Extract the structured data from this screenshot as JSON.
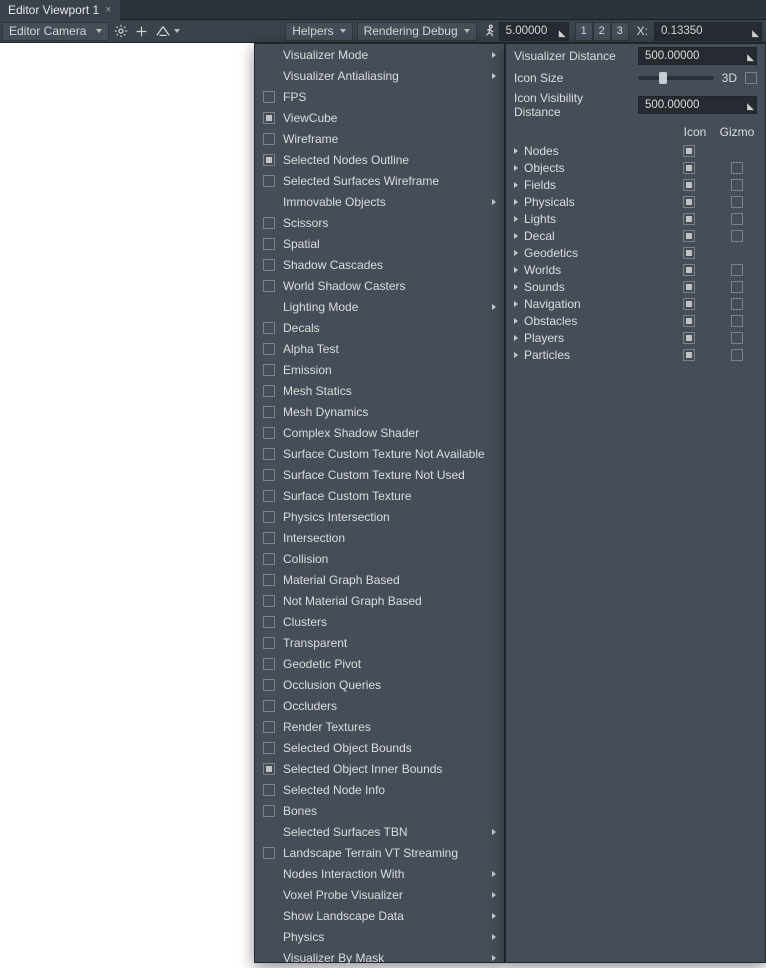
{
  "title": "Editor Viewport 1",
  "camera_dropdown": "Editor Camera",
  "toolbar": {
    "helpers": "Helpers",
    "rendering_debug": "Rendering Debug",
    "speed": "5.00000",
    "views": [
      "1",
      "2",
      "3"
    ],
    "axis_label": "X:",
    "axis_value": "0.13350"
  },
  "helpers_menu": [
    {
      "k": "sub",
      "label": "Visualizer Mode"
    },
    {
      "k": "sub",
      "label": "Visualizer Antialiasing"
    },
    {
      "k": "cb",
      "label": "FPS"
    },
    {
      "k": "ind",
      "label": "ViewCube"
    },
    {
      "k": "cb",
      "label": "Wireframe"
    },
    {
      "k": "ind",
      "label": "Selected Nodes Outline"
    },
    {
      "k": "cb",
      "label": "Selected Surfaces Wireframe"
    },
    {
      "k": "sub",
      "label": "Immovable Objects"
    },
    {
      "k": "cb",
      "label": "Scissors"
    },
    {
      "k": "cb",
      "label": "Spatial"
    },
    {
      "k": "cb",
      "label": "Shadow Cascades"
    },
    {
      "k": "cb",
      "label": "World Shadow Casters"
    },
    {
      "k": "sub",
      "label": "Lighting Mode"
    },
    {
      "k": "cb",
      "label": "Decals"
    },
    {
      "k": "cb",
      "label": "Alpha Test"
    },
    {
      "k": "cb",
      "label": "Emission"
    },
    {
      "k": "cb",
      "label": "Mesh Statics"
    },
    {
      "k": "cb",
      "label": "Mesh Dynamics"
    },
    {
      "k": "cb",
      "label": "Complex Shadow Shader"
    },
    {
      "k": "cb",
      "label": "Surface Custom Texture Not Available"
    },
    {
      "k": "cb",
      "label": "Surface Custom Texture Not Used"
    },
    {
      "k": "cb",
      "label": "Surface Custom Texture"
    },
    {
      "k": "cb",
      "label": "Physics Intersection"
    },
    {
      "k": "cb",
      "label": "Intersection"
    },
    {
      "k": "cb",
      "label": "Collision"
    },
    {
      "k": "cb",
      "label": "Material Graph Based"
    },
    {
      "k": "cb",
      "label": "Not Material Graph Based"
    },
    {
      "k": "cb",
      "label": "Clusters"
    },
    {
      "k": "cb",
      "label": "Transparent"
    },
    {
      "k": "cb",
      "label": "Geodetic Pivot"
    },
    {
      "k": "cb",
      "label": "Occlusion Queries"
    },
    {
      "k": "cb",
      "label": "Occluders"
    },
    {
      "k": "cb",
      "label": "Render Textures"
    },
    {
      "k": "cb",
      "label": "Selected Object Bounds"
    },
    {
      "k": "ind",
      "label": "Selected Object Inner Bounds"
    },
    {
      "k": "cb",
      "label": "Selected Node Info"
    },
    {
      "k": "cb",
      "label": "Bones"
    },
    {
      "k": "sub",
      "label": "Selected Surfaces TBN"
    },
    {
      "k": "cb",
      "label": "Landscape Terrain VT Streaming"
    },
    {
      "k": "sub",
      "label": "Nodes Interaction With"
    },
    {
      "k": "sub",
      "label": "Voxel Probe Visualizer"
    },
    {
      "k": "sub",
      "label": "Show Landscape Data"
    },
    {
      "k": "sub",
      "label": "Physics"
    },
    {
      "k": "sub",
      "label": "Visualizer By Mask"
    }
  ],
  "right": {
    "vis_dist_label": "Visualizer Distance",
    "vis_dist_value": "500.00000",
    "icon_size_label": "Icon Size",
    "three_d": "3D",
    "icon_vis_label": "Icon Visibility Distance",
    "icon_vis_value": "500.00000",
    "hdr_icon": "Icon",
    "hdr_gizmo": "Gizmo",
    "tree": [
      {
        "label": "Nodes",
        "icon": "on",
        "gizmo": null
      },
      {
        "label": "Objects",
        "icon": "on",
        "gizmo": "off"
      },
      {
        "label": "Fields",
        "icon": "on",
        "gizmo": "off"
      },
      {
        "label": "Physicals",
        "icon": "on",
        "gizmo": "off"
      },
      {
        "label": "Lights",
        "icon": "on",
        "gizmo": "off"
      },
      {
        "label": "Decal",
        "icon": "on",
        "gizmo": "off"
      },
      {
        "label": "Geodetics",
        "icon": "on",
        "gizmo": null
      },
      {
        "label": "Worlds",
        "icon": "on",
        "gizmo": "off"
      },
      {
        "label": "Sounds",
        "icon": "on",
        "gizmo": "off"
      },
      {
        "label": "Navigation",
        "icon": "on",
        "gizmo": "off"
      },
      {
        "label": "Obstacles",
        "icon": "on",
        "gizmo": "off"
      },
      {
        "label": "Players",
        "icon": "on",
        "gizmo": "off"
      },
      {
        "label": "Particles",
        "icon": "on",
        "gizmo": "off"
      }
    ]
  }
}
